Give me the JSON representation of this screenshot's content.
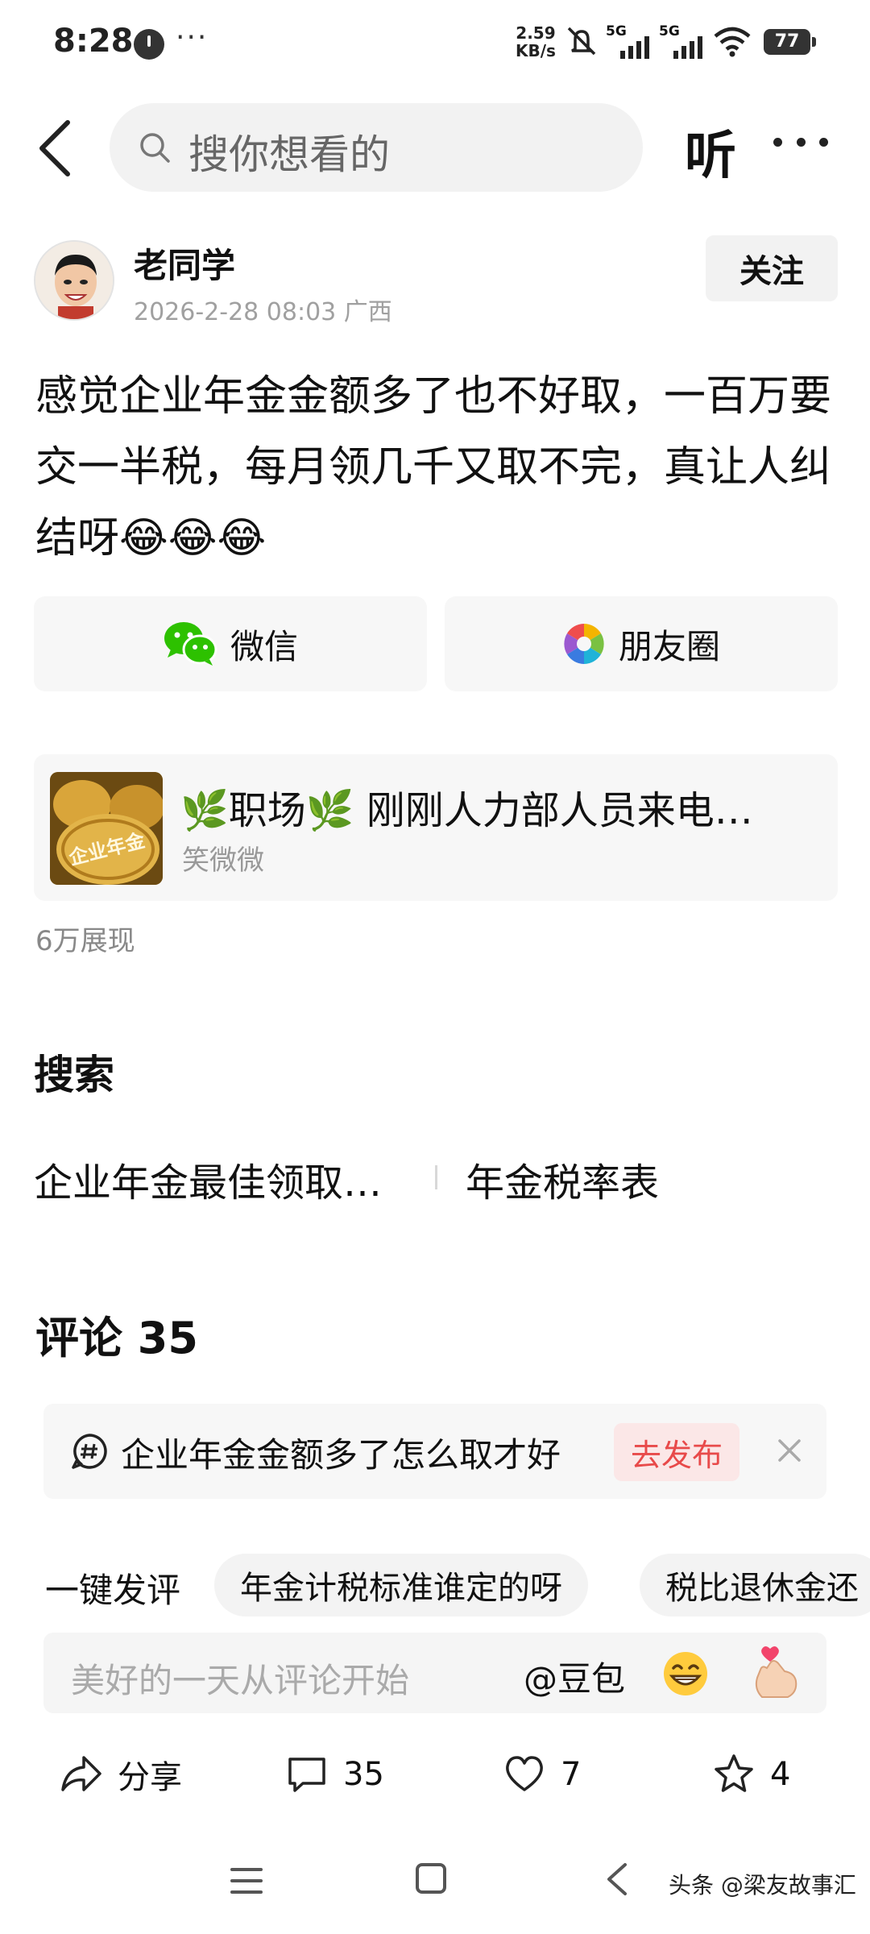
{
  "status_bar": {
    "time": "8:28",
    "dots": "···",
    "net_speed_value": "2.59",
    "net_speed_unit": "KB/s",
    "network_1": "5G",
    "network_2": "5G",
    "battery": "77"
  },
  "header": {
    "search_placeholder": "搜你想看的",
    "listen_label": "听"
  },
  "post": {
    "author_name": "老同学",
    "meta": "2026-2-28 08:03 广西",
    "follow_label": "关注",
    "body": "感觉企业年金金额多了也不好取，一百万要交一半税，每月领几千又取不完，真让人纠结呀😂😂😂",
    "share": {
      "wechat_label": "微信",
      "moments_label": "朋友圈"
    },
    "linked_article": {
      "title": "🌿职场🌿 刚刚人力部人员来电…",
      "author": "笑微微",
      "thumb_text": "企业年金"
    },
    "impressions": "6万展现"
  },
  "search_section": {
    "heading": "搜索",
    "suggestions": [
      "企业年金最佳领取…",
      "年金税率表"
    ]
  },
  "comments": {
    "heading": "评论 35",
    "prompt_text": "企业年金金额多了怎么取才好",
    "publish_label": "去发布",
    "quick_label": "一键发评",
    "chips": [
      "年金计税标准谁定的呀",
      "税比退休金还"
    ],
    "input_placeholder": "美好的一天从评论开始",
    "mention": "@豆包"
  },
  "action_bar": {
    "share_label": "分享",
    "comment_count": "35",
    "like_count": "7",
    "favorite_count": "4"
  },
  "watermark": "头条 @梁友故事汇",
  "colors": {
    "publish_red": "#e84a4a",
    "wechat_green": "#2dc100",
    "muted_gray": "#a0a0a0"
  }
}
